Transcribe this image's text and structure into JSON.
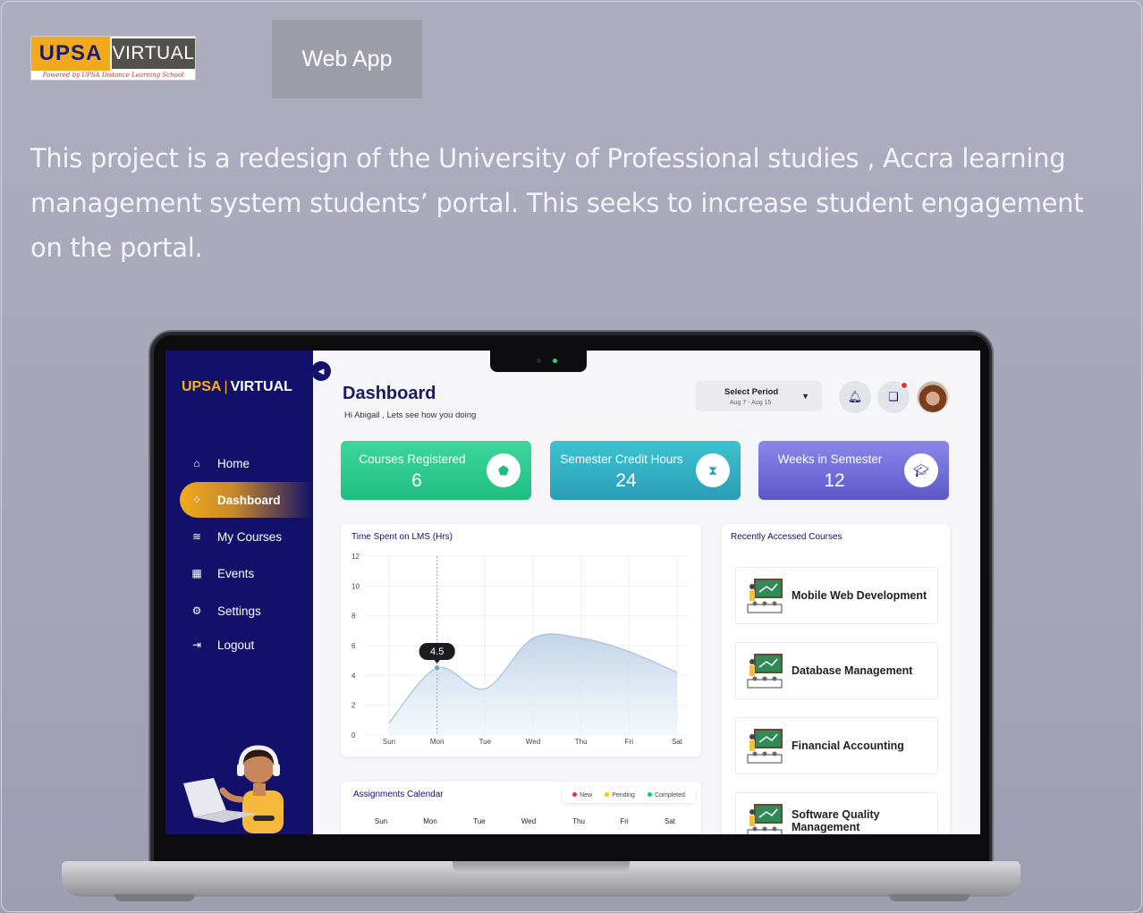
{
  "header": {
    "logo": {
      "left": "UPSA",
      "right": "VIRTUAL",
      "tagline": "Powered by UPSA Distance Learning School"
    },
    "badge": "Web App",
    "intro": "This project is a redesign of the University of Professional studies , Accra learning management system students’ portal. This seeks to increase student engagement on the portal."
  },
  "sidebar": {
    "brand_left": "UPSA",
    "brand_sep": "|",
    "brand_right": "VIRTUAL",
    "collapse_icon": "chevron-left-icon",
    "items": [
      {
        "label": "Home",
        "icon": "home-icon",
        "glyph": "⌂",
        "active": false
      },
      {
        "label": "Dashboard",
        "icon": "grid-icon",
        "glyph": "⁘",
        "active": true
      },
      {
        "label": "My Courses",
        "icon": "layers-icon",
        "glyph": "≋",
        "active": false
      },
      {
        "label": "Events",
        "icon": "calendar-icon",
        "glyph": "▦",
        "active": false
      },
      {
        "label": "Settings",
        "icon": "gear-icon",
        "glyph": "⚙",
        "active": false
      },
      {
        "label": "Logout",
        "icon": "logout-icon",
        "glyph": "⇥",
        "active": false
      }
    ]
  },
  "main": {
    "title": "Dashboard",
    "greeting": "Hi Abigail , Lets see how you doing",
    "period": {
      "label": "Select Period",
      "range": "Aug 7 - Aug 15"
    },
    "stats": [
      {
        "label": "Courses Registered",
        "value": "6",
        "icon": "courses-icon"
      },
      {
        "label": "Semester Credit Hours",
        "value": "24",
        "icon": "hourglass-icon"
      },
      {
        "label": "Weeks in Semester",
        "value": "12",
        "icon": "graduation-cap-icon"
      }
    ],
    "recent": {
      "title": "Recently Accessed Courses",
      "courses": [
        "Mobile Web Development",
        "Database Management",
        "Financial Accounting",
        "Software Quality Management"
      ]
    },
    "calendar": {
      "title": "Assignments Calendar",
      "legend": [
        {
          "label": "New",
          "color": "#e63232"
        },
        {
          "label": "Pending",
          "color": "#f5c518"
        },
        {
          "label": "Completed",
          "color": "#1fbd82"
        }
      ],
      "days": [
        "Sun",
        "Mon",
        "Tue",
        "Wed",
        "Thu",
        "Fri",
        "Sat"
      ]
    }
  },
  "chart_data": {
    "type": "area",
    "title": "Time Spent on LMS (Hrs)",
    "categories": [
      "Sun",
      "Mon",
      "Tue",
      "Wed",
      "Thu",
      "Fri",
      "Sat"
    ],
    "ylim": [
      0,
      12
    ],
    "yticks": [
      0,
      2,
      4,
      6,
      8,
      10,
      12
    ],
    "series": [
      {
        "values": [
          0.8,
          4.5,
          3.1,
          6.5,
          6.5,
          5.6,
          4.2
        ]
      }
    ],
    "highlight": {
      "category": "Mon",
      "label": "4.5"
    },
    "grid": true,
    "fill_color": "#bcd1e6"
  }
}
